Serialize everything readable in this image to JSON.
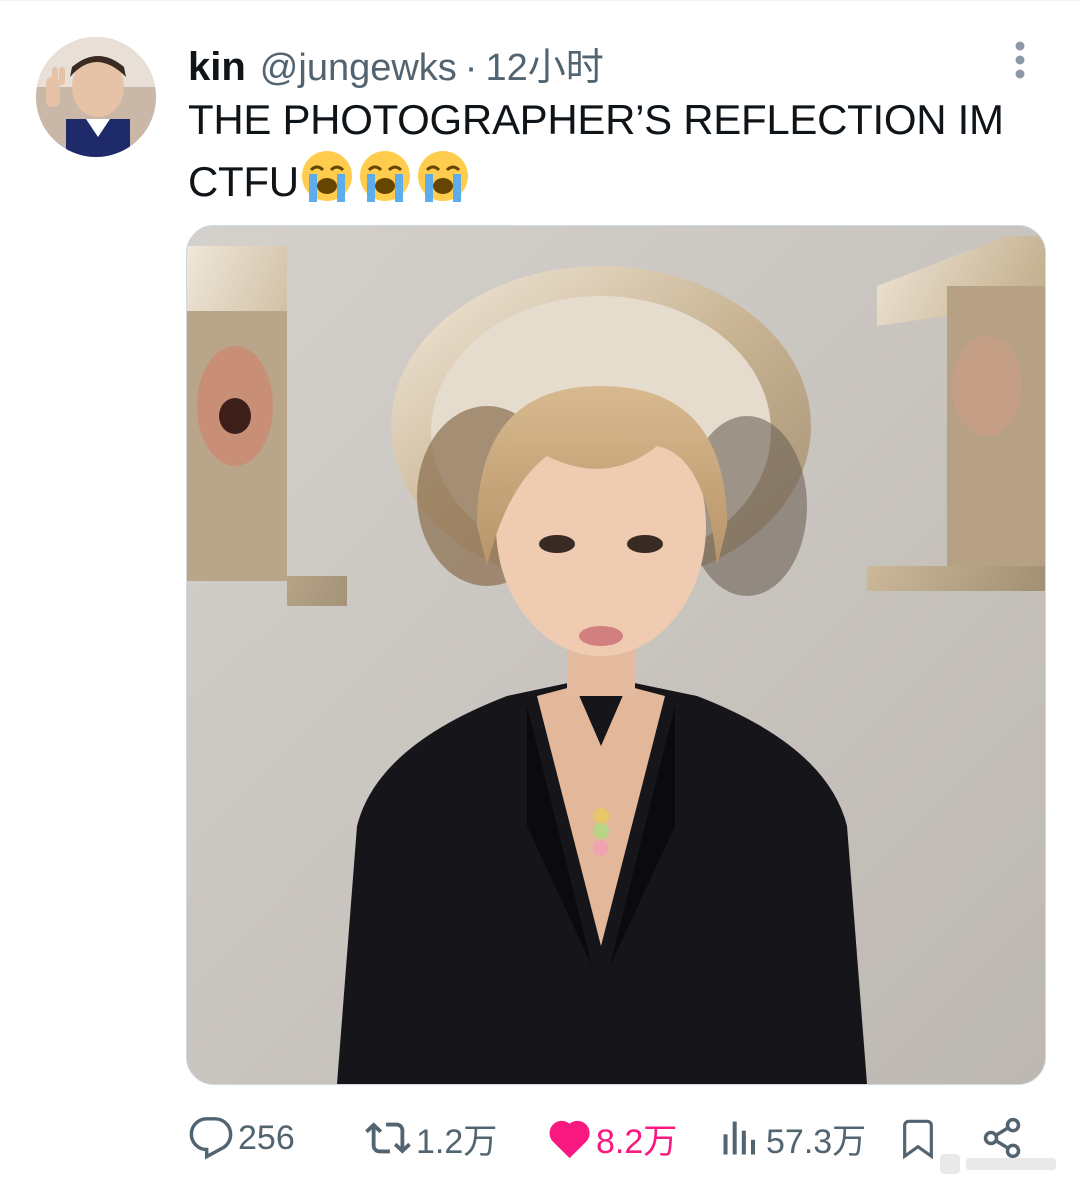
{
  "tweet": {
    "display_name": "kin",
    "handle": "@jungewks",
    "separator": "·",
    "time": "12小时",
    "text": "THE PHOTOGRAPHER’S REFLECTION IM CTFU",
    "emojis": [
      "loudly-crying-face",
      "loudly-crying-face",
      "loudly-crying-face"
    ],
    "avatar_icon": "user-avatar",
    "media_description_icon": "photo"
  },
  "actions": {
    "reply_count": "256",
    "retweet_count": "1.2万",
    "like_count": "8.2万",
    "view_count": "57.3万"
  },
  "colors": {
    "text_primary": "#0f1419",
    "text_secondary": "#536471",
    "like_active": "#f91880",
    "border": "#cfd9de"
  }
}
